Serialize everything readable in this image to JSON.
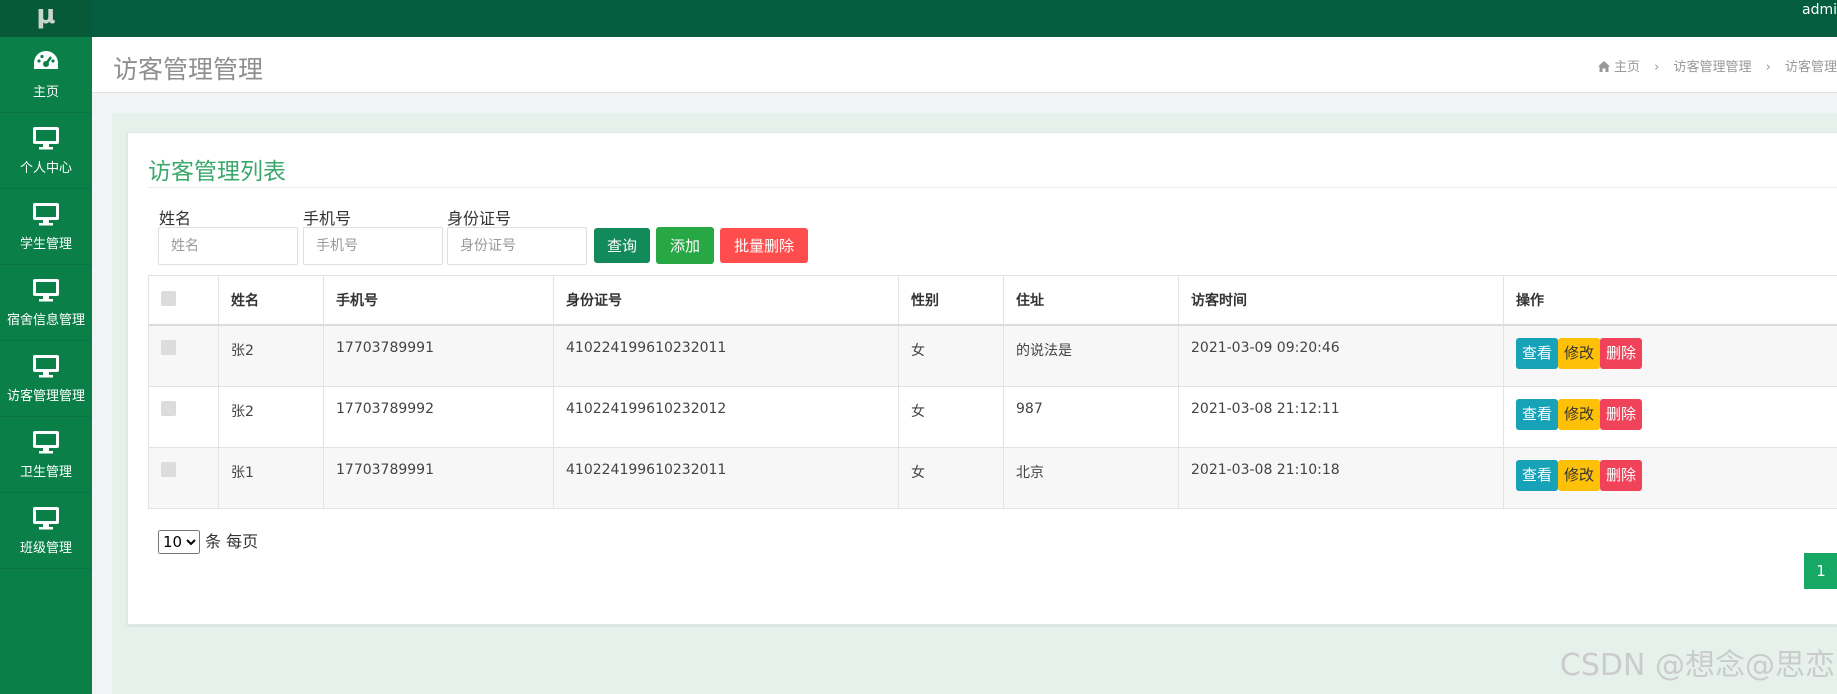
{
  "app": {
    "logo": "μ",
    "user": "admi"
  },
  "sidebar": {
    "items": [
      {
        "label": "主页",
        "icon": "dashboard-icon"
      },
      {
        "label": "个人中心",
        "icon": "monitor-icon"
      },
      {
        "label": "学生管理",
        "icon": "monitor-icon"
      },
      {
        "label": "宿舍信息管理",
        "icon": "monitor-icon"
      },
      {
        "label": "访客管理管理",
        "icon": "monitor-icon"
      },
      {
        "label": "卫生管理",
        "icon": "monitor-icon"
      },
      {
        "label": "班级管理",
        "icon": "monitor-icon"
      }
    ]
  },
  "header": {
    "title": "访客管理管理",
    "breadcrumb": [
      "主页",
      "访客管理管理",
      "访客管理"
    ]
  },
  "panel": {
    "title": "访客管理列表"
  },
  "filters": {
    "name": {
      "label": "姓名",
      "placeholder": "姓名"
    },
    "phone": {
      "label": "手机号",
      "placeholder": "手机号"
    },
    "idcard": {
      "label": "身份证号",
      "placeholder": "身份证号"
    }
  },
  "buttons": {
    "search": "查询",
    "add": "添加",
    "batch_delete": "批量删除"
  },
  "table": {
    "columns": [
      "姓名",
      "手机号",
      "身份证号",
      "性别",
      "住址",
      "访客时间",
      "操作"
    ],
    "rows": [
      {
        "name": "张2",
        "phone": "17703789991",
        "idcard": "410224199610232011",
        "gender": "女",
        "address": "的说法是",
        "time": "2021-03-09 09:20:46"
      },
      {
        "name": "张2",
        "phone": "17703789992",
        "idcard": "410224199610232012",
        "gender": "女",
        "address": "987",
        "time": "2021-03-08 21:12:11"
      },
      {
        "name": "张1",
        "phone": "17703789991",
        "idcard": "410224199610232011",
        "gender": "女",
        "address": "北京",
        "time": "2021-03-08 21:10:18"
      }
    ],
    "actions": {
      "view": "查看",
      "edit": "修改",
      "delete": "删除"
    }
  },
  "pagination": {
    "page_size": "10",
    "page_size_suffix": "条 每页",
    "current_page": "1"
  },
  "watermark": "CSDN @想念@思恋",
  "colors": {
    "sidebar": "#0a8048",
    "topbar": "#045d3f",
    "accent": "#3aa86b",
    "view": "#17a2b8",
    "edit": "#ffc107",
    "delete": "#f0435a",
    "batch_delete": "#ff4d4d"
  }
}
